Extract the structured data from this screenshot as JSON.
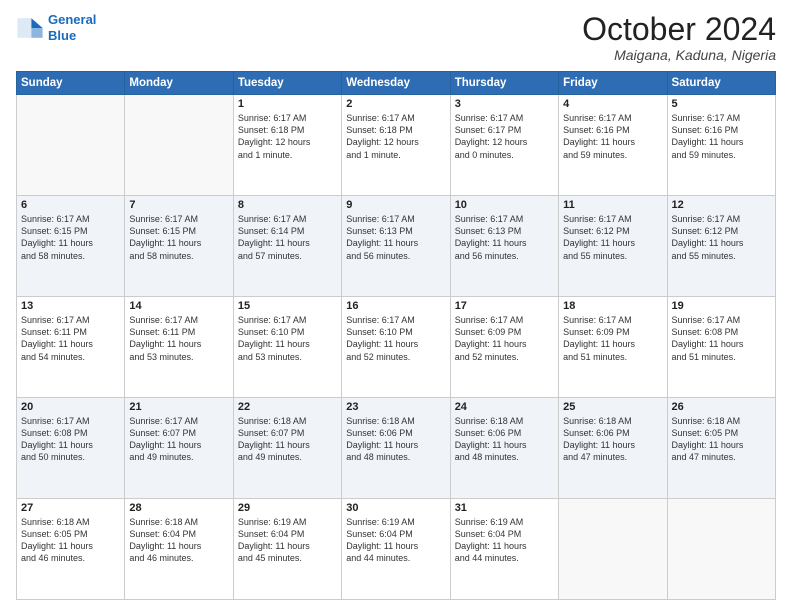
{
  "header": {
    "logo_line1": "General",
    "logo_line2": "Blue",
    "month": "October 2024",
    "location": "Maigana, Kaduna, Nigeria"
  },
  "days_of_week": [
    "Sunday",
    "Monday",
    "Tuesday",
    "Wednesday",
    "Thursday",
    "Friday",
    "Saturday"
  ],
  "weeks": [
    [
      {
        "day": "",
        "content": ""
      },
      {
        "day": "",
        "content": ""
      },
      {
        "day": "1",
        "content": "Sunrise: 6:17 AM\nSunset: 6:18 PM\nDaylight: 12 hours\nand 1 minute."
      },
      {
        "day": "2",
        "content": "Sunrise: 6:17 AM\nSunset: 6:18 PM\nDaylight: 12 hours\nand 1 minute."
      },
      {
        "day": "3",
        "content": "Sunrise: 6:17 AM\nSunset: 6:17 PM\nDaylight: 12 hours\nand 0 minutes."
      },
      {
        "day": "4",
        "content": "Sunrise: 6:17 AM\nSunset: 6:16 PM\nDaylight: 11 hours\nand 59 minutes."
      },
      {
        "day": "5",
        "content": "Sunrise: 6:17 AM\nSunset: 6:16 PM\nDaylight: 11 hours\nand 59 minutes."
      }
    ],
    [
      {
        "day": "6",
        "content": "Sunrise: 6:17 AM\nSunset: 6:15 PM\nDaylight: 11 hours\nand 58 minutes."
      },
      {
        "day": "7",
        "content": "Sunrise: 6:17 AM\nSunset: 6:15 PM\nDaylight: 11 hours\nand 58 minutes."
      },
      {
        "day": "8",
        "content": "Sunrise: 6:17 AM\nSunset: 6:14 PM\nDaylight: 11 hours\nand 57 minutes."
      },
      {
        "day": "9",
        "content": "Sunrise: 6:17 AM\nSunset: 6:13 PM\nDaylight: 11 hours\nand 56 minutes."
      },
      {
        "day": "10",
        "content": "Sunrise: 6:17 AM\nSunset: 6:13 PM\nDaylight: 11 hours\nand 56 minutes."
      },
      {
        "day": "11",
        "content": "Sunrise: 6:17 AM\nSunset: 6:12 PM\nDaylight: 11 hours\nand 55 minutes."
      },
      {
        "day": "12",
        "content": "Sunrise: 6:17 AM\nSunset: 6:12 PM\nDaylight: 11 hours\nand 55 minutes."
      }
    ],
    [
      {
        "day": "13",
        "content": "Sunrise: 6:17 AM\nSunset: 6:11 PM\nDaylight: 11 hours\nand 54 minutes."
      },
      {
        "day": "14",
        "content": "Sunrise: 6:17 AM\nSunset: 6:11 PM\nDaylight: 11 hours\nand 53 minutes."
      },
      {
        "day": "15",
        "content": "Sunrise: 6:17 AM\nSunset: 6:10 PM\nDaylight: 11 hours\nand 53 minutes."
      },
      {
        "day": "16",
        "content": "Sunrise: 6:17 AM\nSunset: 6:10 PM\nDaylight: 11 hours\nand 52 minutes."
      },
      {
        "day": "17",
        "content": "Sunrise: 6:17 AM\nSunset: 6:09 PM\nDaylight: 11 hours\nand 52 minutes."
      },
      {
        "day": "18",
        "content": "Sunrise: 6:17 AM\nSunset: 6:09 PM\nDaylight: 11 hours\nand 51 minutes."
      },
      {
        "day": "19",
        "content": "Sunrise: 6:17 AM\nSunset: 6:08 PM\nDaylight: 11 hours\nand 51 minutes."
      }
    ],
    [
      {
        "day": "20",
        "content": "Sunrise: 6:17 AM\nSunset: 6:08 PM\nDaylight: 11 hours\nand 50 minutes."
      },
      {
        "day": "21",
        "content": "Sunrise: 6:17 AM\nSunset: 6:07 PM\nDaylight: 11 hours\nand 49 minutes."
      },
      {
        "day": "22",
        "content": "Sunrise: 6:18 AM\nSunset: 6:07 PM\nDaylight: 11 hours\nand 49 minutes."
      },
      {
        "day": "23",
        "content": "Sunrise: 6:18 AM\nSunset: 6:06 PM\nDaylight: 11 hours\nand 48 minutes."
      },
      {
        "day": "24",
        "content": "Sunrise: 6:18 AM\nSunset: 6:06 PM\nDaylight: 11 hours\nand 48 minutes."
      },
      {
        "day": "25",
        "content": "Sunrise: 6:18 AM\nSunset: 6:06 PM\nDaylight: 11 hours\nand 47 minutes."
      },
      {
        "day": "26",
        "content": "Sunrise: 6:18 AM\nSunset: 6:05 PM\nDaylight: 11 hours\nand 47 minutes."
      }
    ],
    [
      {
        "day": "27",
        "content": "Sunrise: 6:18 AM\nSunset: 6:05 PM\nDaylight: 11 hours\nand 46 minutes."
      },
      {
        "day": "28",
        "content": "Sunrise: 6:18 AM\nSunset: 6:04 PM\nDaylight: 11 hours\nand 46 minutes."
      },
      {
        "day": "29",
        "content": "Sunrise: 6:19 AM\nSunset: 6:04 PM\nDaylight: 11 hours\nand 45 minutes."
      },
      {
        "day": "30",
        "content": "Sunrise: 6:19 AM\nSunset: 6:04 PM\nDaylight: 11 hours\nand 44 minutes."
      },
      {
        "day": "31",
        "content": "Sunrise: 6:19 AM\nSunset: 6:04 PM\nDaylight: 11 hours\nand 44 minutes."
      },
      {
        "day": "",
        "content": ""
      },
      {
        "day": "",
        "content": ""
      }
    ]
  ]
}
